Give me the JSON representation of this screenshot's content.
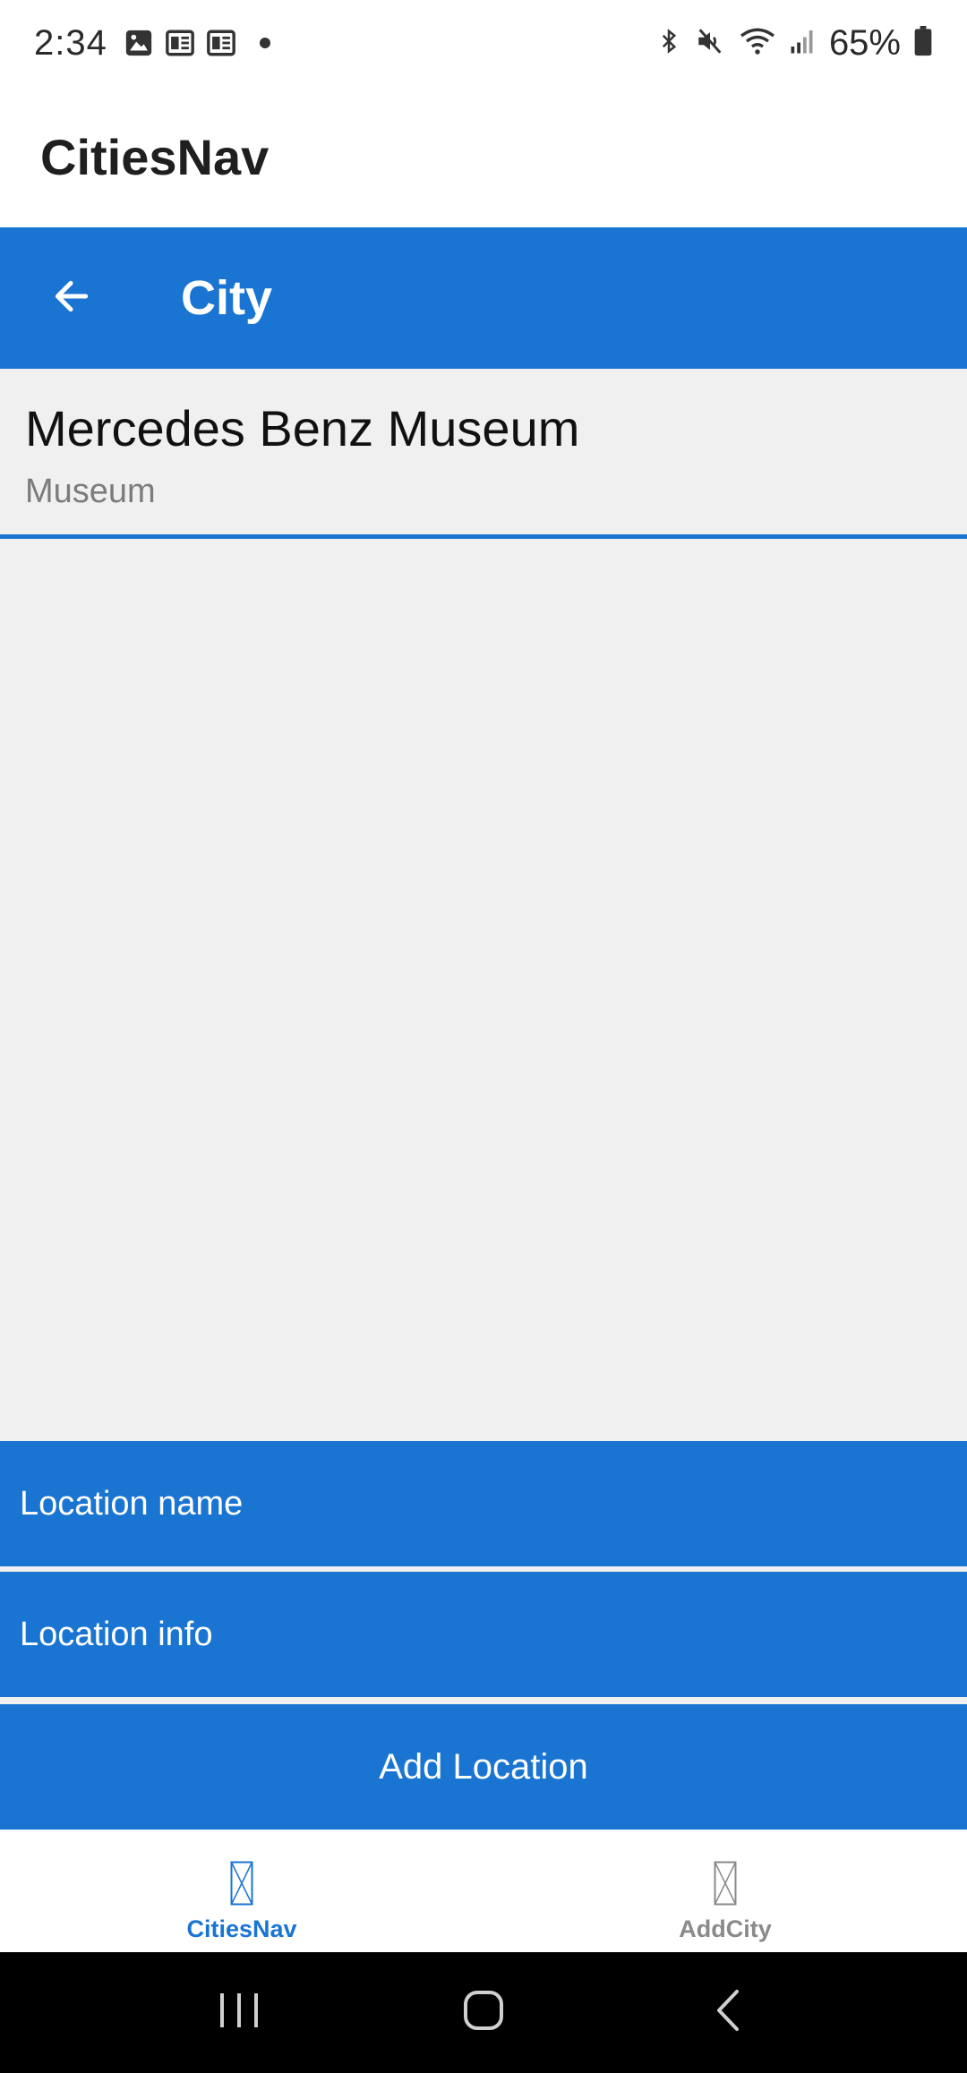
{
  "status_bar": {
    "time": "2:34",
    "battery_text": "65%",
    "icons": [
      "image-notification-icon",
      "news-notification-icon",
      "news-notification-icon",
      "dot-icon",
      "bluetooth-icon",
      "mute-icon",
      "wifi-icon",
      "signal-icon",
      "battery-icon"
    ]
  },
  "app": {
    "title": "CitiesNav"
  },
  "nav": {
    "title": "City",
    "back_icon": "arrow-back-icon"
  },
  "locations": [
    {
      "name": "Mercedes Benz Museum",
      "info": "Museum"
    }
  ],
  "form": {
    "name_placeholder": "Location name",
    "info_placeholder": "Location info",
    "add_label": "Add Location"
  },
  "tabs": [
    {
      "label": "CitiesNav",
      "active": true
    },
    {
      "label": "AddCity",
      "active": false
    }
  ],
  "colors": {
    "accent": "#1a75d2",
    "background": "#f0f0f0"
  }
}
